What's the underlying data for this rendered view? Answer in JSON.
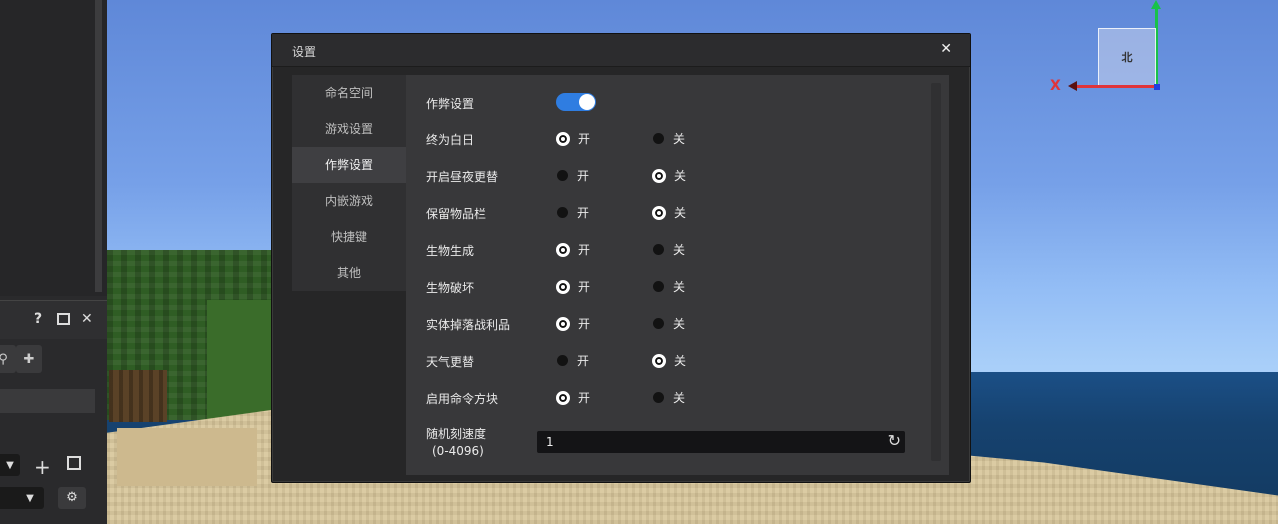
{
  "dialog": {
    "title": "设置",
    "close_icon": "✕"
  },
  "sidebar": {
    "items": [
      {
        "label": "命名空间",
        "active": false
      },
      {
        "label": "游戏设置",
        "active": false
      },
      {
        "label": "作弊设置",
        "active": true
      },
      {
        "label": "内嵌游戏",
        "active": false
      },
      {
        "label": "快捷键",
        "active": false
      },
      {
        "label": "其他",
        "active": false
      }
    ]
  },
  "cheats": {
    "toggle_label": "作弊设置",
    "toggle_on": true,
    "on_label": "开",
    "off_label": "关",
    "rows": [
      {
        "label": "终为白日",
        "value": "on"
      },
      {
        "label": "开启昼夜更替",
        "value": "off"
      },
      {
        "label": "保留物品栏",
        "value": "off"
      },
      {
        "label": "生物生成",
        "value": "on"
      },
      {
        "label": "生物破坏",
        "value": "on"
      },
      {
        "label": "实体掉落战利品",
        "value": "on"
      },
      {
        "label": "天气更替",
        "value": "off"
      },
      {
        "label": "启用命令方块",
        "value": "on"
      }
    ],
    "tick_speed": {
      "label": "随机刻速度",
      "range": "(0-4096)",
      "value": "1",
      "reset_icon": "refresh-icon"
    }
  },
  "gizmo": {
    "north_label": "北",
    "x_label": "X",
    "colors": {
      "x": "#e0343a",
      "y": "#18c24a",
      "z": "#2040e0"
    }
  },
  "left_panel": {
    "help_label": "?",
    "close_label": "✕"
  },
  "colors": {
    "accent": "#2f7de1",
    "dialog_bg": "#262627",
    "content_bg": "#38383a"
  }
}
